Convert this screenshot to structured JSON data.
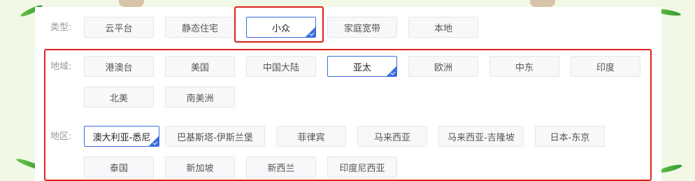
{
  "type_row": {
    "label": "类型:",
    "options": [
      "云平台",
      "静态住宅",
      "小众",
      "家庭宽带",
      "本地"
    ],
    "selected": "小众"
  },
  "region_row": {
    "label": "地域:",
    "options": [
      "港澳台",
      "美国",
      "中国大陆",
      "亚太",
      "欧洲",
      "中东",
      "印度",
      "北美",
      "南美洲"
    ],
    "selected": "亚太"
  },
  "area_row": {
    "label": "地区:",
    "options": [
      "澳大利亚-悉尼",
      "巴基斯塔-伊斯兰堡",
      "菲律宾",
      "马来西亚",
      "马来西亚-吉隆坡",
      "日本-东京",
      "泰国",
      "新加坡",
      "新西兰",
      "印度尼西亚"
    ],
    "selected": "澳大利亚-悉尼"
  },
  "colors": {
    "accent": "#3b6de0",
    "highlight": "#e0211b",
    "background": "#f1f8e6"
  },
  "icons": {
    "selected_marker": "corner-check-icon"
  }
}
